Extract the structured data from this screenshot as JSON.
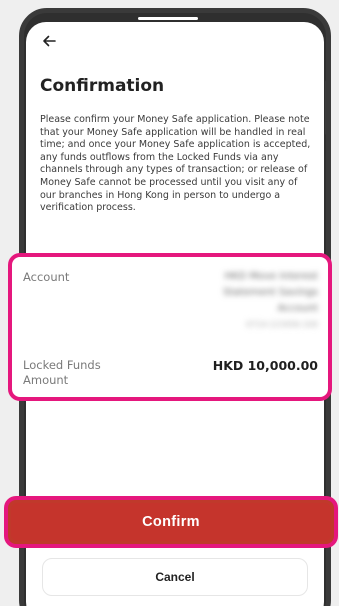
{
  "screen": {
    "title": "Confirmation",
    "body": "Please confirm your Money Safe application. Please note that your Money Safe application will be handled in real time; and once your Money Safe application is accepted, any funds outflows from the Locked Funds via any channels through any types of transaction; or release of Money Safe cannot be processed until you visit any of our branches in Hong Kong in person to undergo a verification process."
  },
  "details": {
    "account_label": "Account",
    "account_value_line1": "HKD Move Interest",
    "account_value_line2": "Statement Savings",
    "account_value_line3": "Account",
    "account_value_line4": "0714-123456-100",
    "funds_label": "Locked Funds Amount",
    "funds_value": "HKD 10,000.00"
  },
  "actions": {
    "confirm_label": "Confirm",
    "cancel_label": "Cancel"
  },
  "colors": {
    "highlight": "#e5177d",
    "primary_button": "#c5342c"
  }
}
